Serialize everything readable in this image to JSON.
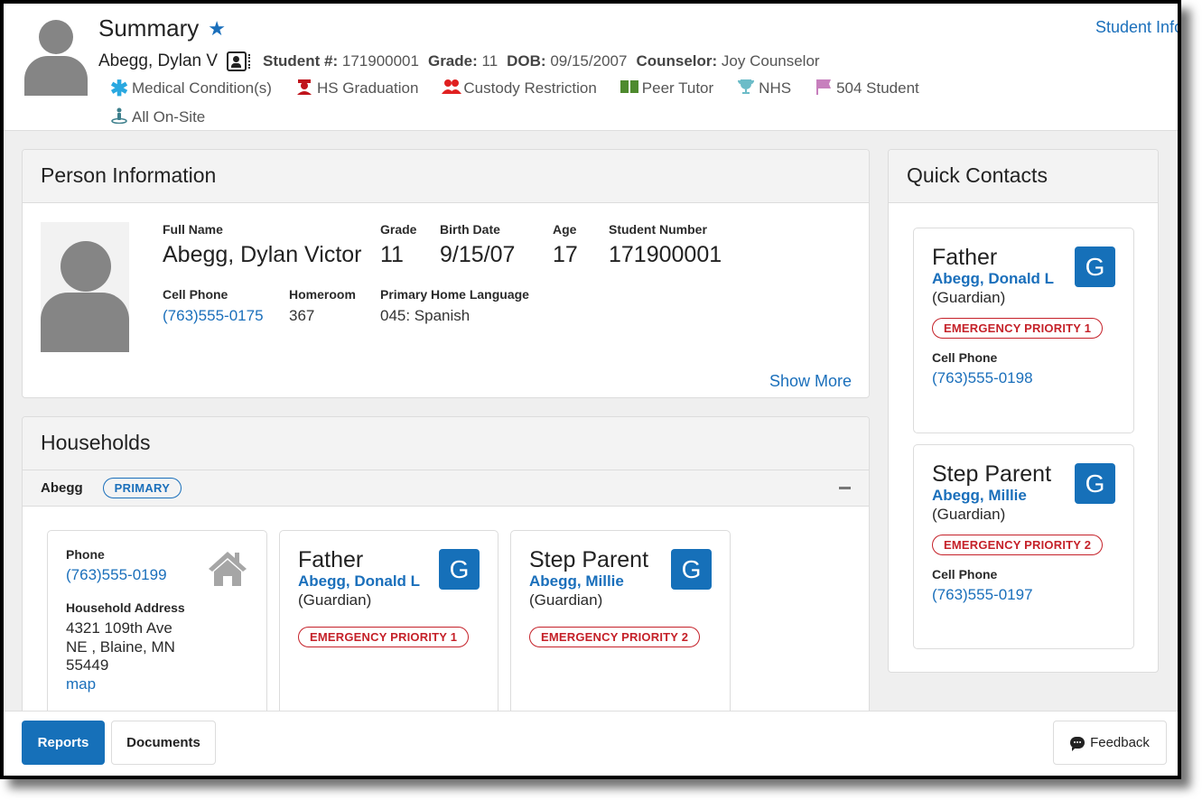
{
  "header": {
    "title": "Summary",
    "favorite_icon": "star-icon",
    "student_info_link": "Student Info",
    "student_name": "Abegg, Dylan V",
    "meta": [
      {
        "label": "Student #:",
        "value": "171900001"
      },
      {
        "label": "Grade:",
        "value": "11"
      },
      {
        "label": "DOB:",
        "value": "09/15/2007"
      },
      {
        "label": "Counselor:",
        "value": "Joy Counselor"
      }
    ],
    "flags": [
      {
        "icon": "asterisk-icon",
        "label": "Medical Condition(s)",
        "color": "#29a8e0"
      },
      {
        "icon": "graduate-icon",
        "label": "HS Graduation",
        "color": "#c0141c"
      },
      {
        "icon": "users-icon",
        "label": "Custody Restriction",
        "color": "#e02020"
      },
      {
        "icon": "book-icon",
        "label": "Peer Tutor",
        "color": "#4e8a2e"
      },
      {
        "icon": "trophy-icon",
        "label": "NHS",
        "color": "#6cbcc8"
      },
      {
        "icon": "flag-icon",
        "label": "504 Student",
        "color": "#c77fbd"
      },
      {
        "icon": "person-location-icon",
        "label": "All On-Site",
        "color": "#3d7f8c"
      }
    ]
  },
  "person_information": {
    "title": "Person Information",
    "fields": {
      "full_name": {
        "label": "Full Name",
        "value": "Abegg, Dylan Victor"
      },
      "grade": {
        "label": "Grade",
        "value": "11"
      },
      "birth_date": {
        "label": "Birth Date",
        "value": "9/15/07"
      },
      "age": {
        "label": "Age",
        "value": "17"
      },
      "student_number": {
        "label": "Student Number",
        "value": "171900001"
      },
      "cell_phone": {
        "label": "Cell Phone",
        "value": "(763)555-0175"
      },
      "homeroom": {
        "label": "Homeroom",
        "value": "367"
      },
      "home_language": {
        "label": "Primary Home Language",
        "value": "045: Spanish"
      }
    },
    "show_more": "Show More"
  },
  "households": {
    "title": "Households",
    "household_name": "Abegg",
    "primary_badge": "PRIMARY",
    "info": {
      "phone_label": "Phone",
      "phone": "(763)555-0199",
      "address_label": "Household Address",
      "address": "4321 109th Ave NE , Blaine, MN 55449",
      "map_link": "map"
    },
    "contacts": [
      {
        "relationship": "Father",
        "name": "Abegg, Donald L",
        "role": "(Guardian)",
        "badge": "G",
        "priority": "EMERGENCY PRIORITY 1"
      },
      {
        "relationship": "Step Parent",
        "name": "Abegg, Millie",
        "role": "(Guardian)",
        "badge": "G",
        "priority": "EMERGENCY PRIORITY 2"
      }
    ]
  },
  "quick_contacts": {
    "title": "Quick Contacts",
    "contacts": [
      {
        "relationship": "Father",
        "name": "Abegg, Donald L",
        "role": "(Guardian)",
        "badge": "G",
        "priority": "EMERGENCY PRIORITY 1",
        "phone_label": "Cell Phone",
        "phone": "(763)555-0198"
      },
      {
        "relationship": "Step Parent",
        "name": "Abegg, Millie",
        "role": "(Guardian)",
        "badge": "G",
        "priority": "EMERGENCY PRIORITY 2",
        "phone_label": "Cell Phone",
        "phone": "(763)555-0197"
      }
    ]
  },
  "footer": {
    "reports": "Reports",
    "documents": "Documents",
    "feedback": "Feedback"
  },
  "colors": {
    "accent": "#1670b9",
    "link": "#1a6fbb",
    "emergency": "#c52129"
  }
}
